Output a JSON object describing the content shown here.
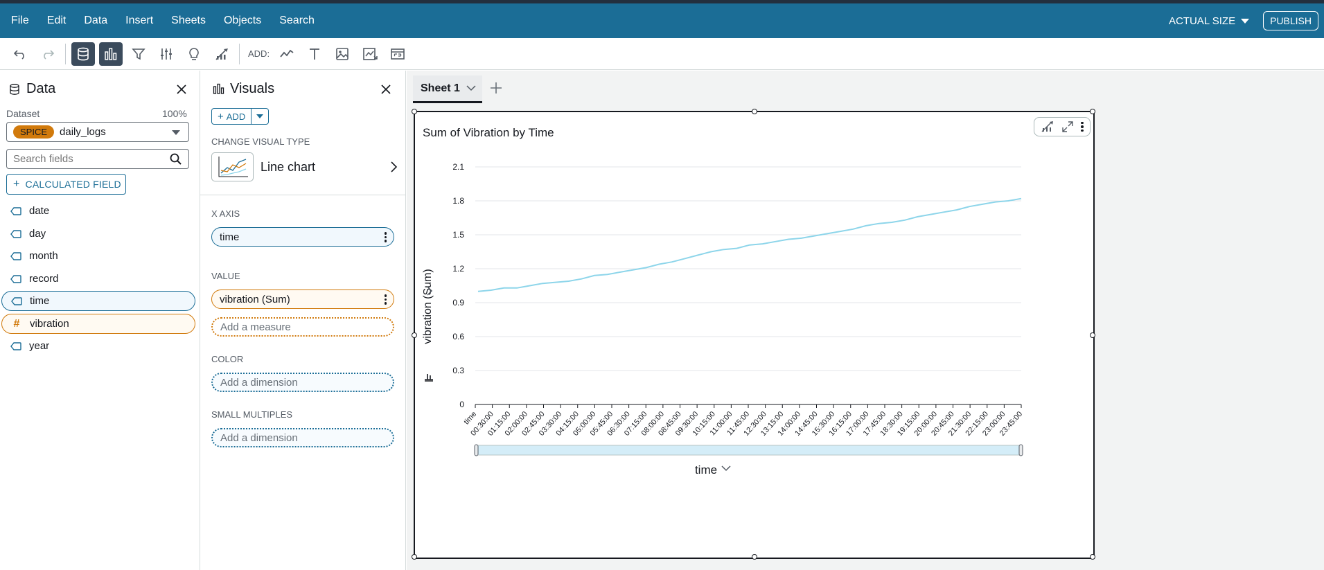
{
  "menu": [
    "File",
    "Edit",
    "Data",
    "Insert",
    "Sheets",
    "Objects",
    "Search"
  ],
  "menu_right": {
    "actual_size": "ACTUAL SIZE",
    "publish": "PUBLISH"
  },
  "toolbar": {
    "add_label": "ADD:"
  },
  "data_panel": {
    "title": "Data",
    "dataset_label": "Dataset",
    "dataset_pct": "100%",
    "spice_badge": "SPICE",
    "dataset_name": "daily_logs",
    "search_placeholder": "Search fields",
    "calc_field": "CALCULATED FIELD",
    "fields": [
      {
        "name": "date",
        "type": "dimension",
        "selected": false
      },
      {
        "name": "day",
        "type": "dimension",
        "selected": false
      },
      {
        "name": "month",
        "type": "dimension",
        "selected": false
      },
      {
        "name": "record",
        "type": "dimension",
        "selected": false
      },
      {
        "name": "time",
        "type": "dimension",
        "selected": true
      },
      {
        "name": "vibration",
        "type": "measure",
        "selected": true
      },
      {
        "name": "year",
        "type": "dimension",
        "selected": false
      }
    ]
  },
  "visuals_panel": {
    "title": "Visuals",
    "add": "ADD",
    "change_type_label": "CHANGE VISUAL TYPE",
    "visual_type": "Line chart",
    "x_axis_label": "X AXIS",
    "x_axis_field": "time",
    "value_label": "VALUE",
    "value_field": "vibration (Sum)",
    "add_measure": "Add a measure",
    "color_label": "COLOR",
    "add_dimension_color": "Add a dimension",
    "small_multiples_label": "SMALL MULTIPLES",
    "add_dimension_sm": "Add a dimension"
  },
  "sheet": {
    "tab": "Sheet 1"
  },
  "visual": {
    "title": "Sum of Vibration by Time",
    "x_field_button": "time"
  },
  "colors": {
    "menubar": "#1b6d96",
    "line": "#8dd5ea",
    "spice": "#d17a0c"
  },
  "chart_data": {
    "type": "line",
    "title": "Sum of Vibration by Time",
    "xlabel": "time",
    "ylabel": "vibration (Sum)",
    "ylim": [
      0,
      2.1
    ],
    "yticks": [
      0,
      0.3,
      0.6,
      0.9,
      1.2,
      1.5,
      1.8,
      2.1
    ],
    "xtick_labels": [
      "time",
      "00:30:00",
      "01:15:00",
      "02:00:00",
      "02:45:00",
      "03:30:00",
      "04:15:00",
      "05:00:00",
      "05:45:00",
      "06:30:00",
      "07:15:00",
      "08:00:00",
      "08:45:00",
      "09:30:00",
      "10:15:00",
      "11:00:00",
      "11:45:00",
      "12:30:00",
      "13:15:00",
      "14:00:00",
      "14:45:00",
      "15:30:00",
      "16:15:00",
      "17:00:00",
      "17:45:00",
      "18:30:00",
      "19:15:00",
      "20:00:00",
      "20:45:00",
      "21:30:00",
      "22:15:00",
      "23:00:00",
      "23:45:00"
    ],
    "series": [
      {
        "values": [
          1.0,
          1.01,
          1.03,
          1.03,
          1.05,
          1.07,
          1.08,
          1.09,
          1.11,
          1.14,
          1.15,
          1.17,
          1.19,
          1.21,
          1.24,
          1.26,
          1.29,
          1.32,
          1.35,
          1.37,
          1.38,
          1.41,
          1.42,
          1.44,
          1.46,
          1.47,
          1.49,
          1.51,
          1.53,
          1.55,
          1.58,
          1.6,
          1.61,
          1.63,
          1.66,
          1.68,
          1.7,
          1.72,
          1.75,
          1.77,
          1.79,
          1.8,
          1.82
        ]
      }
    ],
    "grid": true,
    "legend": "none"
  }
}
